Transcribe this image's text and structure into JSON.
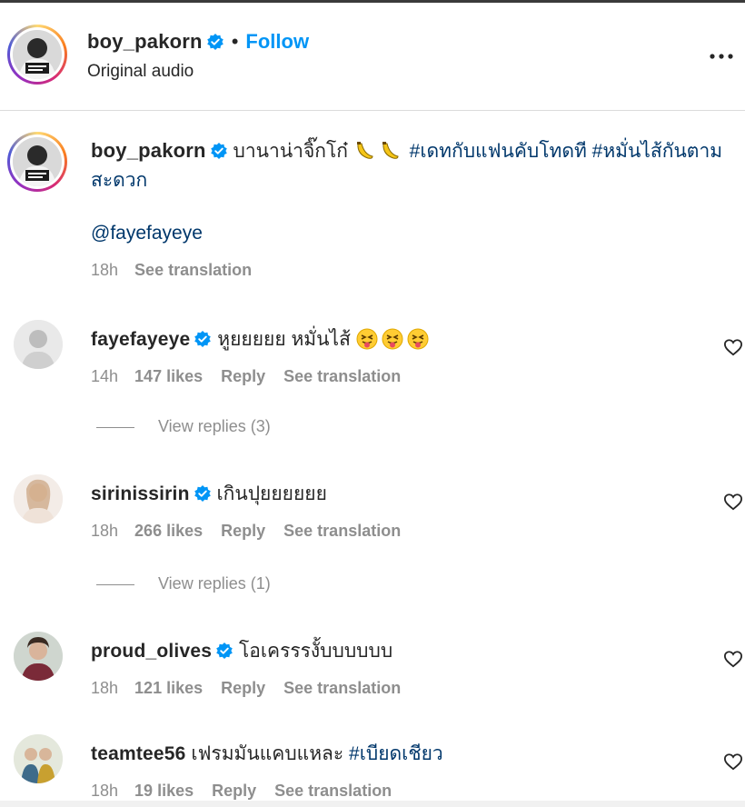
{
  "post": {
    "username": "boy_pakorn",
    "separator": "•",
    "follow_label": "Follow",
    "audio": "Original audio"
  },
  "caption": {
    "username": "boy_pakorn",
    "text": "บานาน่าจิ๊กโก๋",
    "hashtag_1": "#เดทกับแฟนคับโทดที",
    "hashtag_2": "#หมั่นไส้กันตามสะดวก",
    "mention": "@fayefayeye",
    "time": "18h",
    "see_translation": "See translation"
  },
  "comments": [
    {
      "username": "fayefayeye",
      "text": "หูยยยยย หมั่นไส้",
      "time": "14h",
      "likes": "147 likes",
      "reply": "Reply",
      "see_translation": "See translation",
      "view_replies": "View replies (3)"
    },
    {
      "username": "sirinissirin",
      "text": "เกินปุยยยยยย",
      "time": "18h",
      "likes": "266 likes",
      "reply": "Reply",
      "see_translation": "See translation",
      "view_replies": "View replies (1)"
    },
    {
      "username": "proud_olives",
      "text": "โอเครรรงั้บบบบบบ",
      "time": "18h",
      "likes": "121 likes",
      "reply": "Reply",
      "see_translation": "See translation"
    },
    {
      "username": "teamtee56",
      "text": "เฟรมมันแคบแหละ",
      "hashtag": "#เบียดเชียว",
      "time": "18h",
      "likes": "19 likes",
      "reply": "Reply",
      "see_translation": "See translation"
    }
  ],
  "icons": {
    "verified": "verified-badge-icon",
    "more": "more-options-icon",
    "like": "heart-icon",
    "banana": "banana-emoji",
    "tongue": "squinting-tongue-emoji"
  },
  "colors": {
    "follow": "#0095f6",
    "hashtag": "#00376b",
    "verified": "#0095f6",
    "meta": "#8e8e8e"
  }
}
